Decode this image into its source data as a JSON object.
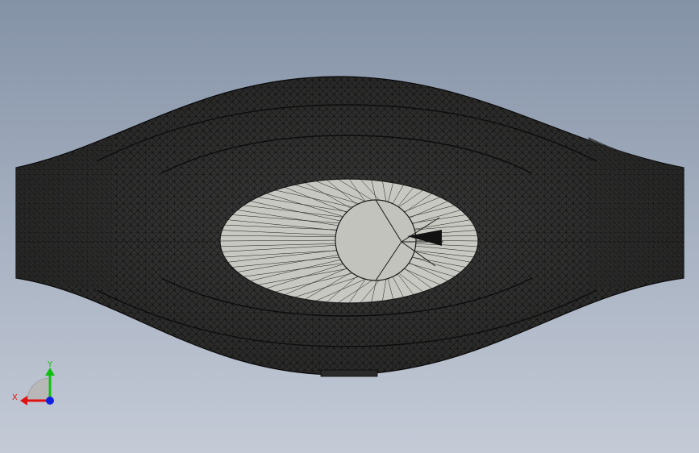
{
  "viewport": {
    "background_top": "#8492a6",
    "background_bottom": "#c4cad6"
  },
  "model": {
    "render_style": "wireframe-shaded",
    "mesh_fill": "#3b3b3a",
    "mesh_line": "#111111",
    "inner_fill": "#c8c8c2"
  },
  "triad": {
    "x_label": "X",
    "y_label": "Y",
    "x_color": "#e01010",
    "y_color": "#10c010",
    "z_color": "#1020e0"
  }
}
